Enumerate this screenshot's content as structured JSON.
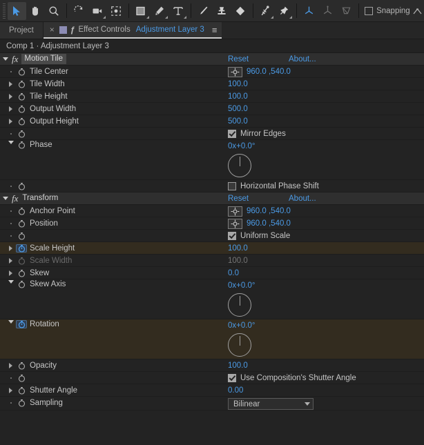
{
  "toolbar": {
    "tools": [
      {
        "name": "selection-tool",
        "glyph": "arrow",
        "active": true,
        "dim": false,
        "corner": false
      },
      {
        "name": "hand-tool",
        "glyph": "hand",
        "active": false,
        "dim": false,
        "corner": false
      },
      {
        "name": "zoom-tool",
        "glyph": "magnifier",
        "active": false,
        "dim": false,
        "corner": false
      },
      {
        "name": "rotation-tool",
        "glyph": "rotate",
        "active": false,
        "dim": false,
        "corner": false
      },
      {
        "name": "camera-tool",
        "glyph": "camera",
        "active": false,
        "dim": false,
        "corner": true
      },
      {
        "name": "pan-behind-tool",
        "glyph": "anchor",
        "active": false,
        "dim": false,
        "corner": false
      },
      {
        "name": "shape-tool",
        "glyph": "square",
        "active": false,
        "dim": false,
        "corner": true
      },
      {
        "name": "pen-tool",
        "glyph": "pen",
        "active": false,
        "dim": false,
        "corner": true
      },
      {
        "name": "type-tool",
        "glyph": "type",
        "active": false,
        "dim": false,
        "corner": true
      },
      {
        "name": "brush-tool",
        "glyph": "brush",
        "active": false,
        "dim": false,
        "corner": false
      },
      {
        "name": "clone-stamp-tool",
        "glyph": "stamp",
        "active": false,
        "dim": false,
        "corner": false
      },
      {
        "name": "eraser-tool",
        "glyph": "eraser",
        "active": false,
        "dim": false,
        "corner": false
      },
      {
        "name": "roto-brush-tool",
        "glyph": "roto",
        "active": false,
        "dim": false,
        "corner": true
      },
      {
        "name": "puppet-pin-tool",
        "glyph": "pin",
        "active": false,
        "dim": false,
        "corner": true
      }
    ],
    "axis_tools": [
      {
        "name": "local-axis-mode",
        "glyph": "axis-local",
        "dim": false
      },
      {
        "name": "world-axis-mode",
        "glyph": "axis-world",
        "dim": true
      },
      {
        "name": "view-axis-mode",
        "glyph": "axis-view",
        "dim": true
      }
    ],
    "snapping_label": "Snapping",
    "snapping_checked": false
  },
  "tabs": {
    "project_label": "Project",
    "close_glyph": "×",
    "lock_glyph": "ƒ",
    "effect_controls_label": "Effect Controls",
    "layer_name": "Adjustment Layer 3",
    "menu_glyph": "≡"
  },
  "breadcrumb": "Comp 1 · Adjustment Layer 3",
  "effects": [
    {
      "name": "Motion Tile",
      "selected": true,
      "expanded": true,
      "reset_label": "Reset",
      "about_label": "About...",
      "properties": [
        {
          "label": "Tile Center",
          "type": "point",
          "value": "960.0 ,540.0",
          "twirl": "dot",
          "keyframed": false,
          "disabled": false,
          "highlight": false
        },
        {
          "label": "Tile Width",
          "type": "number",
          "value": "100.0",
          "twirl": "right",
          "keyframed": false,
          "disabled": false,
          "highlight": false
        },
        {
          "label": "Tile Height",
          "type": "number",
          "value": "100.0",
          "twirl": "right",
          "keyframed": false,
          "disabled": false,
          "highlight": false
        },
        {
          "label": "Output Width",
          "type": "number",
          "value": "500.0",
          "twirl": "right",
          "keyframed": false,
          "disabled": false,
          "highlight": false
        },
        {
          "label": "Output Height",
          "type": "number",
          "value": "500.0",
          "twirl": "right",
          "keyframed": false,
          "disabled": false,
          "highlight": false
        },
        {
          "label": "",
          "type": "checkbox",
          "value": "Mirror Edges",
          "checked": true,
          "twirl": "dot",
          "keyframed": false,
          "disabled": false,
          "highlight": false
        },
        {
          "label": "Phase",
          "type": "angle",
          "value": "0x+0.0°",
          "twirl": "down",
          "keyframed": false,
          "disabled": false,
          "highlight": false
        },
        {
          "label": "",
          "type": "checkbox",
          "value": "Horizontal Phase Shift",
          "checked": false,
          "twirl": "dot",
          "keyframed": false,
          "disabled": false,
          "highlight": false
        }
      ]
    },
    {
      "name": "Transform",
      "selected": false,
      "expanded": true,
      "reset_label": "Reset",
      "about_label": "About...",
      "properties": [
        {
          "label": "Anchor Point",
          "type": "point",
          "value": "960.0 ,540.0",
          "twirl": "dot",
          "keyframed": false,
          "disabled": false,
          "highlight": false
        },
        {
          "label": "Position",
          "type": "point",
          "value": "960.0 ,540.0",
          "twirl": "dot",
          "keyframed": false,
          "disabled": false,
          "highlight": false
        },
        {
          "label": "",
          "type": "checkbox",
          "value": "Uniform Scale",
          "checked": true,
          "twirl": "dot",
          "keyframed": false,
          "disabled": false,
          "highlight": false
        },
        {
          "label": "Scale Height",
          "type": "number",
          "value": "100.0",
          "twirl": "right",
          "keyframed": true,
          "disabled": false,
          "highlight": true
        },
        {
          "label": "Scale Width",
          "type": "number",
          "value": "100.0",
          "twirl": "right",
          "keyframed": false,
          "disabled": true,
          "highlight": false
        },
        {
          "label": "Skew",
          "type": "number",
          "value": "0.0",
          "twirl": "right",
          "keyframed": false,
          "disabled": false,
          "highlight": false
        },
        {
          "label": "Skew Axis",
          "type": "angle",
          "value": "0x+0.0°",
          "twirl": "down",
          "keyframed": false,
          "disabled": false,
          "highlight": false
        },
        {
          "label": "Rotation",
          "type": "angle",
          "value": "0x+0.0°",
          "twirl": "down",
          "keyframed": true,
          "disabled": false,
          "highlight": true
        },
        {
          "label": "Opacity",
          "type": "number",
          "value": "100.0",
          "twirl": "right",
          "keyframed": false,
          "disabled": false,
          "highlight": false
        },
        {
          "label": "",
          "type": "checkbox",
          "value": "Use Composition's Shutter Angle",
          "checked": true,
          "twirl": "dot",
          "keyframed": false,
          "disabled": false,
          "highlight": false
        },
        {
          "label": "Shutter Angle",
          "type": "number",
          "value": "0.00",
          "twirl": "right",
          "keyframed": false,
          "disabled": false,
          "highlight": false
        },
        {
          "label": "Sampling",
          "type": "select",
          "value": "Bilinear",
          "twirl": "dot",
          "keyframed": false,
          "disabled": false,
          "highlight": false
        }
      ]
    }
  ],
  "colors": {
    "accent_blue": "#4b9ae5",
    "panel_bg": "#232323",
    "header_bg": "#2f2f2f",
    "highlight_row": "#332c1f"
  }
}
